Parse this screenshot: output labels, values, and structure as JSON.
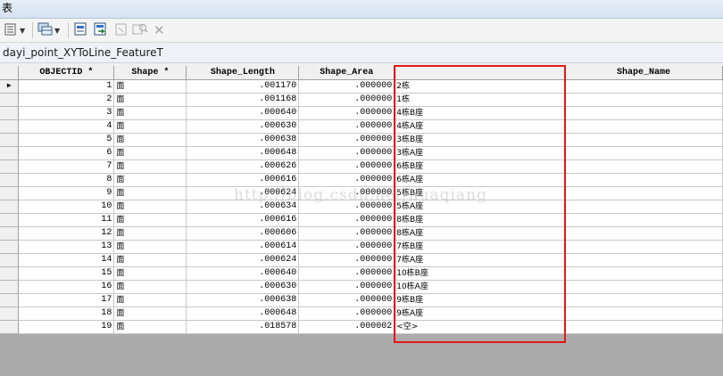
{
  "window": {
    "title": "表"
  },
  "toolbar": {
    "icons": [
      "table-options-icon",
      "dropdown-icon",
      "related-tables-icon",
      "dropdown-icon",
      "select-by-attributes-icon",
      "switch-selection-icon",
      "clear-selection-icon",
      "zoom-to-selected-icon",
      "delete-selected-icon"
    ]
  },
  "tab": {
    "label": "dayi_point_XYToLine_FeatureT"
  },
  "table": {
    "columns": [
      "OBJECTID *",
      "Shape *",
      "Shape_Length",
      "Shape_Area",
      "",
      "Shape_Name"
    ],
    "rows": [
      {
        "id": "1",
        "shape": "面",
        "length": ".001170",
        "area": ".000000",
        "name": "2栋"
      },
      {
        "id": "2",
        "shape": "面",
        "length": ".001168",
        "area": ".000000",
        "name": "1栋"
      },
      {
        "id": "3",
        "shape": "面",
        "length": ".000640",
        "area": ".000000",
        "name": "4栋B座"
      },
      {
        "id": "4",
        "shape": "面",
        "length": ".000630",
        "area": ".000000",
        "name": "4栋A座"
      },
      {
        "id": "5",
        "shape": "面",
        "length": ".000638",
        "area": ".000000",
        "name": "3栋B座"
      },
      {
        "id": "6",
        "shape": "面",
        "length": ".000648",
        "area": ".000000",
        "name": "3栋A座"
      },
      {
        "id": "7",
        "shape": "面",
        "length": ".000626",
        "area": ".000000",
        "name": "6栋B座"
      },
      {
        "id": "8",
        "shape": "面",
        "length": ".000616",
        "area": ".000000",
        "name": "6栋A座"
      },
      {
        "id": "9",
        "shape": "面",
        "length": ".000624",
        "area": ".000000",
        "name": "5栋B座"
      },
      {
        "id": "10",
        "shape": "面",
        "length": ".000634",
        "area": ".000000",
        "name": "5栋A座"
      },
      {
        "id": "11",
        "shape": "面",
        "length": ".000616",
        "area": ".000000",
        "name": "8栋B座"
      },
      {
        "id": "12",
        "shape": "面",
        "length": ".000606",
        "area": ".000000",
        "name": "8栋A座"
      },
      {
        "id": "13",
        "shape": "面",
        "length": ".000614",
        "area": ".000000",
        "name": "7栋B座"
      },
      {
        "id": "14",
        "shape": "面",
        "length": ".000624",
        "area": ".000000",
        "name": "7栋A座"
      },
      {
        "id": "15",
        "shape": "面",
        "length": ".000640",
        "area": ".000000",
        "name": "10栋B座"
      },
      {
        "id": "16",
        "shape": "面",
        "length": ".000630",
        "area": ".000000",
        "name": "10栋A座"
      },
      {
        "id": "17",
        "shape": "面",
        "length": ".000638",
        "area": ".000000",
        "name": "9栋B座"
      },
      {
        "id": "18",
        "shape": "面",
        "length": ".000648",
        "area": ".000000",
        "name": "9栋A座"
      },
      {
        "id": "19",
        "shape": "面",
        "length": ".018578",
        "area": ".000002",
        "name": "<空>"
      }
    ]
  },
  "highlight": {
    "color": "#e0191b"
  },
  "watermark": {
    "text": "http://blog.csdn.net/huaqiang"
  }
}
